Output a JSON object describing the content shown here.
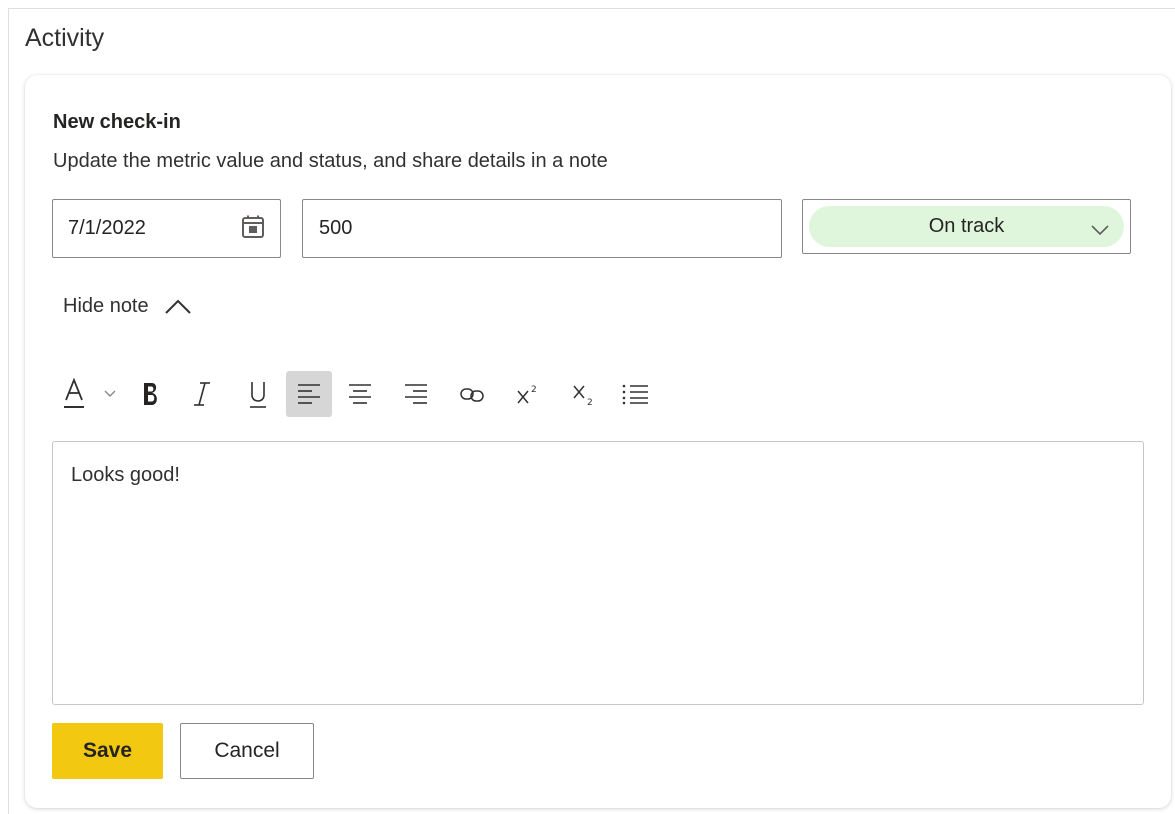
{
  "section": {
    "title": "Activity"
  },
  "checkin": {
    "heading": "New check-in",
    "description": "Update the metric value and status, and share details in a note",
    "date_value": "7/1/2022",
    "metric_value": "500",
    "status": {
      "label": "On track",
      "color": "#dff6dd"
    },
    "toggle_note_label": "Hide note"
  },
  "toolbar": {
    "items": [
      {
        "icon": "font-color-icon",
        "label": "A"
      },
      {
        "icon": "chevron-down-icon"
      },
      {
        "icon": "bold-icon",
        "label": "B"
      },
      {
        "icon": "italic-icon",
        "label": "I"
      },
      {
        "icon": "underline-icon",
        "label": "U"
      },
      {
        "icon": "align-left-icon",
        "active": true
      },
      {
        "icon": "align-center-icon"
      },
      {
        "icon": "align-right-icon"
      },
      {
        "icon": "link-icon"
      },
      {
        "icon": "superscript-icon"
      },
      {
        "icon": "subscript-icon"
      },
      {
        "icon": "bullet-list-icon"
      }
    ]
  },
  "note": {
    "text": "Looks good!"
  },
  "actions": {
    "save_label": "Save",
    "cancel_label": "Cancel",
    "save_color": "#f2c811"
  }
}
